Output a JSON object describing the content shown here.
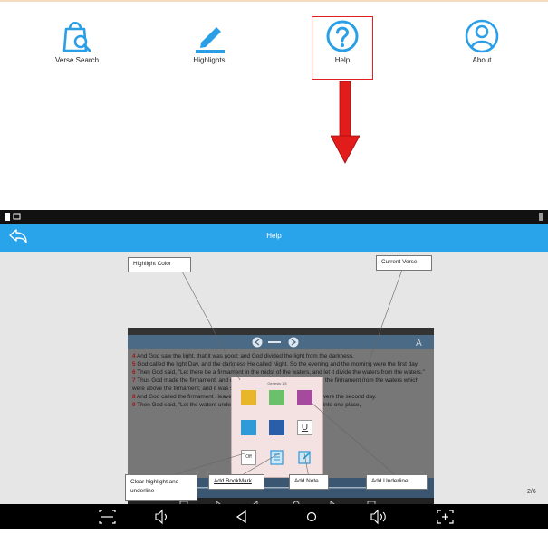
{
  "menu": {
    "items": [
      {
        "label": "Verse Search",
        "icon": "bag-search-icon"
      },
      {
        "label": "Highlights",
        "icon": "pencil-icon"
      },
      {
        "label": "Help",
        "icon": "question-circle-icon"
      },
      {
        "label": "About",
        "icon": "user-circle-icon"
      }
    ],
    "accent": "#2b9fe6",
    "highlight_border": "#e02020"
  },
  "app": {
    "title": "Help",
    "page_indicator": "2/6",
    "bar_color": "#29a3ea"
  },
  "callouts": {
    "highlight_color": "Highlight Color",
    "current_verse": "Current Verse",
    "clear_highlight": "Clear highlight and underline",
    "add_bookmark": "Add BookMark",
    "add_note": "Add Note",
    "add_underline": "Add Underline"
  },
  "inner": {
    "popup_title": "Genesis 1:5",
    "clear_btn": "Off",
    "underline_btn": "U",
    "verses": [
      {
        "num": "4",
        "text": "And God saw the light, that it was good; and God divided the light from the darkness."
      },
      {
        "num": "5",
        "text": "God called the light Day, and the darkness He called Night. So the evening and the morning were the first day."
      },
      {
        "num": "6",
        "text": "Then God said, \"Let there be a firmament in the midst of the waters, and let it divide the waters from the waters.\""
      },
      {
        "num": "7",
        "text": "Thus God made the firmament, and divided the waters which were under the firmament from the waters which were above the firmament; and it was so."
      },
      {
        "num": "8",
        "text": "And God called the firmament Heaven. So the evening and the morning were the second day."
      },
      {
        "num": "9",
        "text": "Then God said, \"Let the waters under the heavens be gathered together into one place,"
      }
    ],
    "swatches": [
      "#e8b62a",
      "#6cc06c",
      "#a64a9e",
      "#2e9ad8",
      "#2a5ea8"
    ]
  }
}
